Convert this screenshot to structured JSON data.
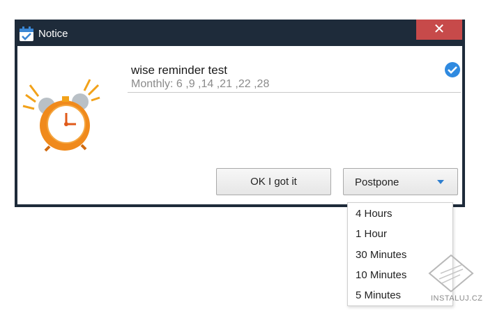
{
  "window": {
    "title": "Notice",
    "close_symbol": "✕"
  },
  "message": {
    "title": "wise reminder test",
    "schedule": "Monthly: 6 ,9 ,14 ,21 ,22 ,28"
  },
  "buttons": {
    "ok_label": "OK I got it",
    "postpone_label": "Postpone"
  },
  "postpone_menu": {
    "options": [
      "4 Hours",
      "1 Hour",
      "30 Minutes",
      "10 Minutes",
      "5 Minutes"
    ]
  },
  "watermark": {
    "text": "INSTALUJ.CZ"
  },
  "icons": {
    "app": "calendar-check-icon",
    "alarm": "alarm-clock-icon",
    "status": "check-circle-icon",
    "dropdown": "caret-down-icon",
    "watermark": "watermark-logo"
  },
  "colors": {
    "titlebar": "#1e2b3a",
    "close_button": "#c74a4a",
    "accent": "#2f8ae0",
    "clock_orange": "#f08a1c"
  }
}
